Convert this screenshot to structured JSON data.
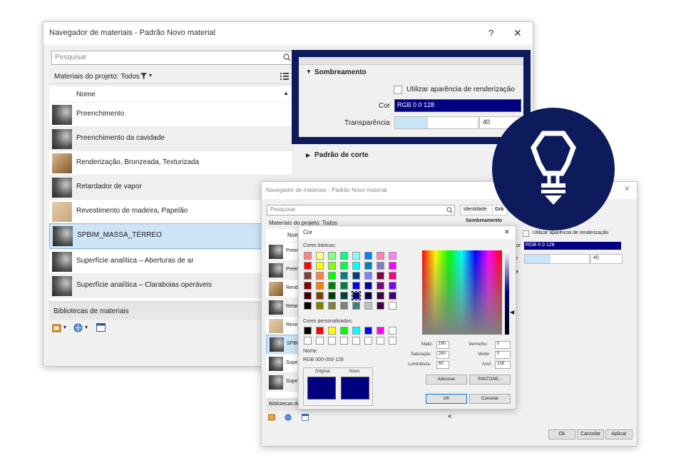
{
  "back_window": {
    "title": "Navegador de materiais - Padrão Novo material",
    "help": "?",
    "close": "✕",
    "search_placeholder": "Pesquisar",
    "filter_label": "Materiais do projeto: Todos",
    "column_header": "Nome",
    "materials": [
      "Preenchimento",
      "Preenchimento da cavidade",
      "Renderização, Bronzeada, Texturizada",
      "Retardador de vapor",
      "Revestimento de madeira, Papelão",
      "SPBIM_MASSA_TÉRREO",
      "Superfície analítica – Aberturas de ar",
      "Superfície analítica – Claraboias operáveis"
    ],
    "libraries_label": "Bibliotecas de materiais"
  },
  "zoom_panel": {
    "section_shading": "Sombreamento",
    "use_render_label": "Utilizar aparência de renderização",
    "color_label": "Cor",
    "color_value": "RGB 0 0 128",
    "transparency_label": "Transparência",
    "transparency_value": "40",
    "transparency_level": 0.4,
    "section_cut": "Padrão de corte"
  },
  "front_window": {
    "title": "Navegador de materiais - Padrão Novo material",
    "search_placeholder": "Pesquisar",
    "filter_label": "Materiais do projeto: Todos",
    "column_header": "Nom",
    "row_labels": [
      "Preen",
      "Preen",
      "Rend",
      "Retar",
      "Reve",
      "SPBI",
      "Supe",
      "Supe"
    ],
    "tab_identity": "Identidade",
    "tab_graphics": "Grá",
    "section_shading": "Sombreamento",
    "use_render_label": "Utilizar aparência de renderização",
    "color_value": "RGB 0 0 128",
    "color_label": "Cor",
    "transparency_label": "ce",
    "transparency_value": "40",
    "section_fragment": "e",
    "libraries_label": "Bibliotecas de ma",
    "collapse": "«",
    "ok": "Ok",
    "cancel": "Cancelar",
    "apply": "Aplicar"
  },
  "color_dialog": {
    "title": "Cor",
    "close": "✕",
    "basic_colors_label": "Cores básicas:",
    "custom_colors_label": "Cores personalizadas:",
    "name_label": "Nome:",
    "name_value": "RGB 000-000-128",
    "original_label": "Original",
    "new_label": "Novo",
    "hue_label": "Matiz:",
    "hue_value": "160",
    "saturation_label": "Saturação:",
    "saturation_value": "240",
    "luminance_label": "Luminância:",
    "luminance_value": "60",
    "red_label": "Vermelho:",
    "red_value": "0",
    "green_label": "Verde:",
    "green_value": "0",
    "blue_label": "Azul:",
    "blue_value": "128",
    "add_button": "Adicionar",
    "pantone_button": "PANTONE...",
    "ok_button": "OK",
    "cancel_button": "Cancelar",
    "swatch_color": "#000080",
    "basic_colors": [
      "#ff8080",
      "#ffff80",
      "#80ff80",
      "#00ff80",
      "#80ffff",
      "#0080ff",
      "#ff80c0",
      "#ff80ff",
      "#ff0000",
      "#ffff00",
      "#80ff00",
      "#00ff40",
      "#00ffff",
      "#0080c0",
      "#8080c0",
      "#ff00ff",
      "#804040",
      "#ff8040",
      "#00ff00",
      "#008080",
      "#004080",
      "#8080ff",
      "#800040",
      "#ff0080",
      "#800000",
      "#ff8000",
      "#008000",
      "#008040",
      "#0000ff",
      "#0000a0",
      "#800080",
      "#8000ff",
      "#400000",
      "#804000",
      "#004000",
      "#004040",
      "#000080",
      "#000040",
      "#400040",
      "#400080",
      "#000000",
      "#808000",
      "#808040",
      "#808080",
      "#408080",
      "#c0c0c0",
      "#400040",
      "#ffffff"
    ],
    "custom_colors": [
      "#000000",
      "#ff0000",
      "#ffff00",
      "#00ff00",
      "#00ffff",
      "#0000ff",
      "#ff00ff",
      "#ffffff"
    ]
  },
  "badge": {
    "icon": "lightbulb-icon",
    "color": "#0d1a5c"
  }
}
